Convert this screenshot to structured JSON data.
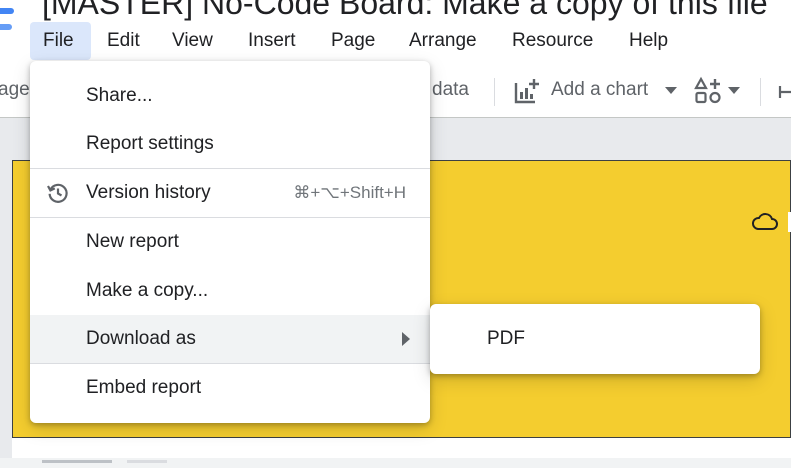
{
  "window": {
    "title": "[MASTER] No-Code Board: Make a copy of this file"
  },
  "menubar": {
    "items": [
      {
        "label": "File",
        "active": true
      },
      {
        "label": "Edit"
      },
      {
        "label": "View"
      },
      {
        "label": "Insert"
      },
      {
        "label": "Page"
      },
      {
        "label": "Arrange"
      },
      {
        "label": "Resource"
      },
      {
        "label": "Help"
      }
    ]
  },
  "toolbar": {
    "left_fragment": "age",
    "data_fragment": "data",
    "add_chart_label": "Add a chart",
    "icons": [
      "add-chart-icon",
      "add-control-icon"
    ]
  },
  "file_menu": {
    "items": [
      {
        "label": "Share..."
      },
      {
        "label": "Report settings"
      },
      {
        "label": "Version history",
        "shortcut": "⌘+⌥+Shift+H",
        "icon": "history-icon"
      },
      {
        "label": "New report"
      },
      {
        "label": "Make a copy..."
      },
      {
        "label": "Download as",
        "has_submenu": true,
        "highlighted": true
      },
      {
        "label": "Embed report"
      }
    ]
  },
  "download_submenu": {
    "items": [
      {
        "label": "PDF"
      }
    ]
  },
  "canvas": {
    "page_color": "#f4cd2f",
    "icons": [
      "cloud-icon"
    ]
  },
  "colors": {
    "active_menu": "#dbe7fb",
    "accent_logo": "#4285f4",
    "report_page": "#f4cd2f"
  }
}
